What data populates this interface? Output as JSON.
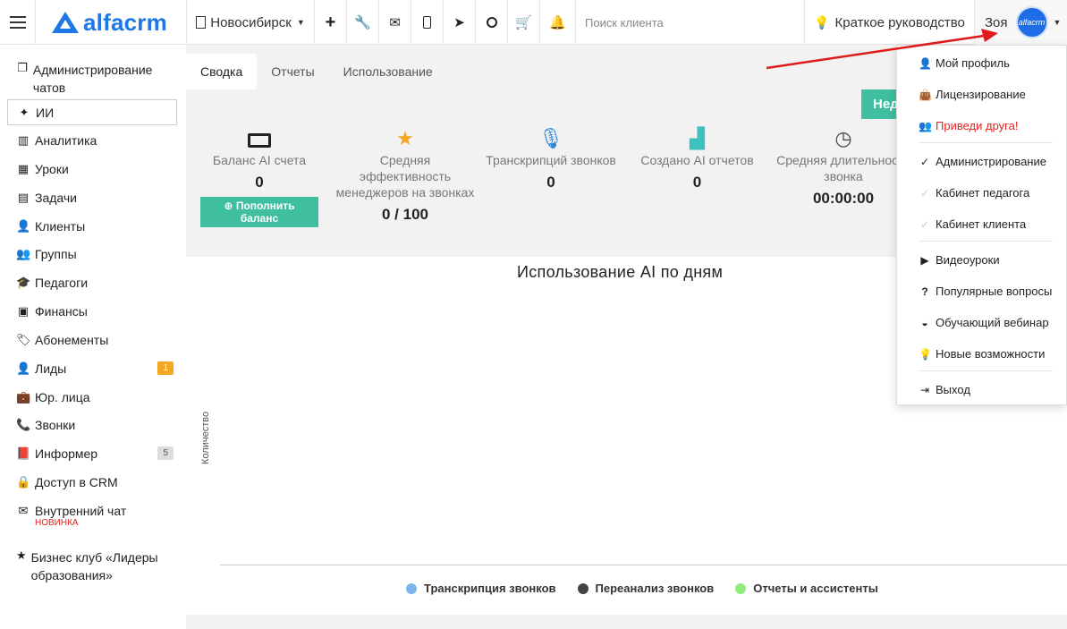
{
  "header": {
    "logo_text": "alfacrm",
    "branch": "Новосибирск",
    "search_placeholder": "Поиск клиента",
    "guide_label": "Краткое руководство",
    "user_name": "Зоя",
    "avatar_text": "alfacrm",
    "icons": [
      "plus-icon",
      "wrench-icon",
      "mail-icon",
      "phone-icon",
      "telegram-icon",
      "whatsapp-icon",
      "cart-icon",
      "bell-icon"
    ]
  },
  "sidebar": {
    "items": [
      {
        "label": "Администрирование чатов"
      },
      {
        "label": "ИИ"
      },
      {
        "label": "Аналитика"
      },
      {
        "label": "Уроки"
      },
      {
        "label": "Задачи"
      },
      {
        "label": "Клиенты"
      },
      {
        "label": "Группы"
      },
      {
        "label": "Педагоги"
      },
      {
        "label": "Финансы"
      },
      {
        "label": "Абонементы"
      },
      {
        "label": "Лиды",
        "badge": "1"
      },
      {
        "label": "Юр. лица"
      },
      {
        "label": "Звонки"
      },
      {
        "label": "Информер",
        "badge": "5"
      },
      {
        "label": "Доступ в CRM"
      },
      {
        "label": "Внутренний чат",
        "sub": "НОВИНКА"
      },
      {
        "label": "Бизнес клуб «Лидеры образования»"
      }
    ]
  },
  "tabs": [
    {
      "label": "Сводка"
    },
    {
      "label": "Отчеты"
    },
    {
      "label": "Использование"
    }
  ],
  "ned_button": "Нед",
  "stats": [
    {
      "label": "Баланс AI счета",
      "value": "0",
      "button": "Пополнить баланс"
    },
    {
      "label": "Средняя эффективность менеджеров на звонках",
      "value": "0 / 100"
    },
    {
      "label": "Транскрипций звонков",
      "value": "0"
    },
    {
      "label": "Создано AI отчетов",
      "value": "0"
    },
    {
      "label": "Средняя длительность звонка",
      "value": "00:00:00"
    }
  ],
  "chart": {
    "title": "Использование AI по дням",
    "ylabel": "Количество",
    "legend": [
      {
        "name": "Транскрипция звонков",
        "color": "#7cb5ec"
      },
      {
        "name": "Переанализ звонков",
        "color": "#434348"
      },
      {
        "name": "Отчеты и ассистенты",
        "color": "#90ed7d"
      }
    ]
  },
  "dropdown": {
    "items": [
      {
        "label": "Мой профиль"
      },
      {
        "label": "Лицензирование"
      },
      {
        "label": "Приведи друга!",
        "color": "#e52222"
      },
      {
        "label": "Администрирование"
      },
      {
        "label": "Кабинет педагога"
      },
      {
        "label": "Кабинет клиента"
      },
      {
        "label": "Видеоуроки"
      },
      {
        "label": "Популярные вопросы"
      },
      {
        "label": "Обучающий вебинар"
      },
      {
        "label": "Новые возможности"
      },
      {
        "label": "Выход"
      }
    ]
  }
}
